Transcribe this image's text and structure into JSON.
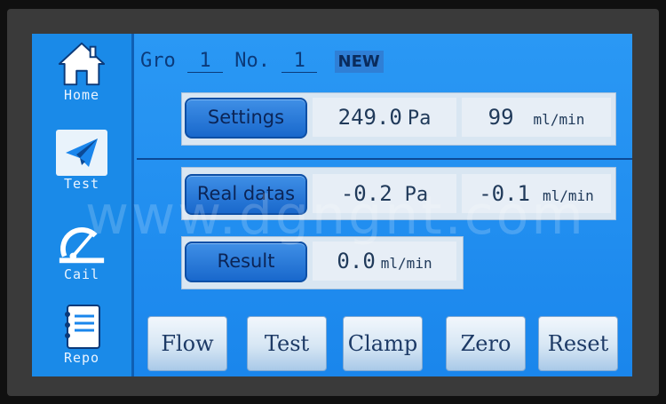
{
  "sidebar": {
    "items": [
      {
        "label": "Home",
        "icon": "house-icon"
      },
      {
        "label": "Test",
        "icon": "paper-plane-icon"
      },
      {
        "label": "Cail",
        "icon": "protractor-icon"
      },
      {
        "label": "Repo",
        "icon": "notebook-icon"
      }
    ]
  },
  "header": {
    "group_label": "Gro",
    "group_value": "1",
    "no_label": "No.",
    "no_value": "1",
    "new_label": "NEW"
  },
  "settings": {
    "button_label": "Settings",
    "pressure_value": "249.0",
    "pressure_unit": "Pa",
    "flow_value": "99",
    "flow_unit": "ml/min"
  },
  "real_datas": {
    "button_label": "Real datas",
    "pressure_value": "-0.2",
    "pressure_unit": "Pa",
    "flow_value": "-0.1",
    "flow_unit": "ml/min"
  },
  "result": {
    "button_label": "Result",
    "flow_value": "0.0",
    "flow_unit": "ml/min"
  },
  "bottom_buttons": [
    "Flow",
    "Test",
    "Clamp",
    "Zero",
    "Reset"
  ],
  "watermark": "www.dgngnt.com",
  "colors": {
    "screen": "#1c8ff0",
    "button": "#1968cc",
    "panel": "#d9e6f2"
  }
}
